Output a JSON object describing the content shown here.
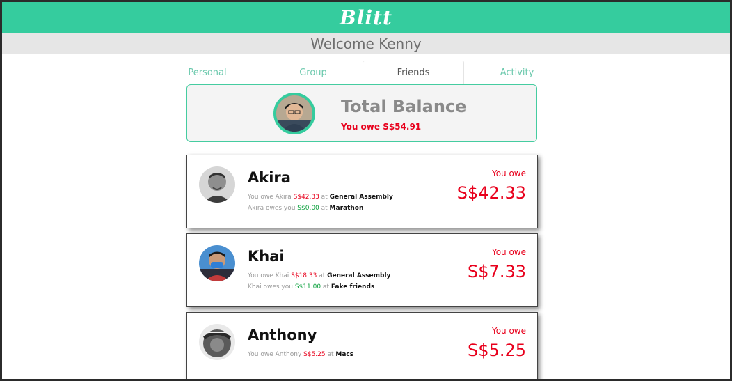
{
  "header": {
    "logo": "Blitt",
    "welcome": "Welcome Kenny"
  },
  "tabs": [
    {
      "label": "Personal",
      "active": false
    },
    {
      "label": "Group",
      "active": false
    },
    {
      "label": "Friends",
      "active": true
    },
    {
      "label": "Activity",
      "active": false
    }
  ],
  "total": {
    "title": "Total Balance",
    "subtitle": "You owe S$54.91"
  },
  "friends": [
    {
      "name": "Akira",
      "owe_label": "You owe",
      "amount": "S$42.33",
      "lines": [
        {
          "prefix": "You owe Akira ",
          "value": "S$42.33",
          "value_color": "red",
          "mid": " at ",
          "place": "General Assembly"
        },
        {
          "prefix": "Akira owes you ",
          "value": "S$0.00",
          "value_color": "green",
          "mid": " at ",
          "place": "Marathon"
        }
      ]
    },
    {
      "name": "Khai",
      "owe_label": "You owe",
      "amount": "S$7.33",
      "lines": [
        {
          "prefix": "You owe Khai ",
          "value": "S$18.33",
          "value_color": "red",
          "mid": " at ",
          "place": "General Assembly"
        },
        {
          "prefix": "Khai owes you ",
          "value": "S$11.00",
          "value_color": "green",
          "mid": " at ",
          "place": "Fake friends"
        }
      ]
    },
    {
      "name": "Anthony",
      "owe_label": "You owe",
      "amount": "S$5.25",
      "lines": [
        {
          "prefix": "You owe Anthony ",
          "value": "S$5.25",
          "value_color": "red",
          "mid": " at ",
          "place": "Macs"
        }
      ]
    }
  ],
  "colors": {
    "brand": "#35cc9e",
    "owe": "#e8001c",
    "owed": "#0aa03c"
  }
}
